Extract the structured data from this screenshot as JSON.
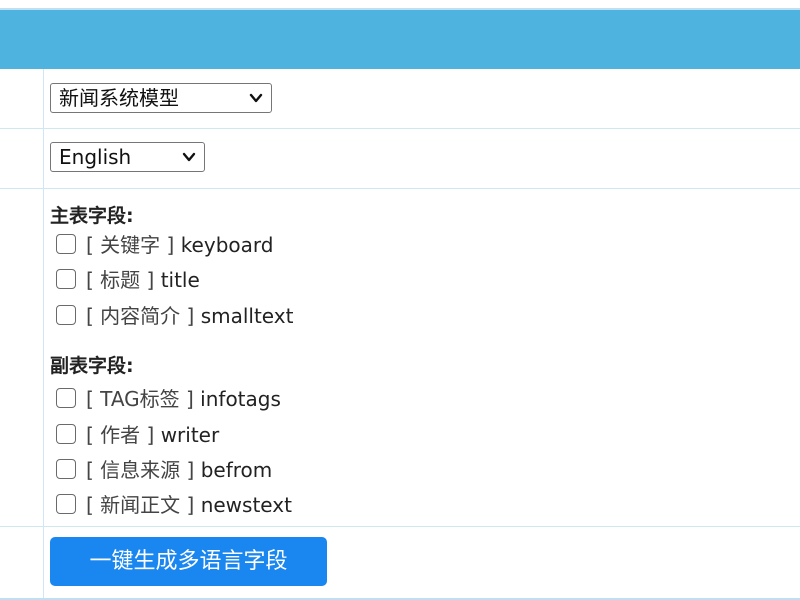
{
  "model_select": {
    "selected": "新闻系统模型"
  },
  "language_select": {
    "selected": "English"
  },
  "main_fields": {
    "title": "主表字段:",
    "items": [
      {
        "cn": "[ 关键字 ]",
        "en": "keyboard"
      },
      {
        "cn": "[ 标题 ]",
        "en": "title"
      },
      {
        "cn": "[ 内容简介 ]",
        "en": "smalltext"
      }
    ]
  },
  "sub_fields": {
    "title": "副表字段:",
    "items": [
      {
        "cn": "[ TAG标签 ]",
        "en": "infotags"
      },
      {
        "cn": "[ 作者 ]",
        "en": "writer"
      },
      {
        "cn": "[ 信息来源 ]",
        "en": "befrom"
      },
      {
        "cn": "[ 新闻正文 ]",
        "en": "newstext"
      }
    ]
  },
  "action": {
    "generate_label": "一键生成多语言字段"
  },
  "colors": {
    "header": "#4fb3df",
    "button": "#1a86f0"
  }
}
